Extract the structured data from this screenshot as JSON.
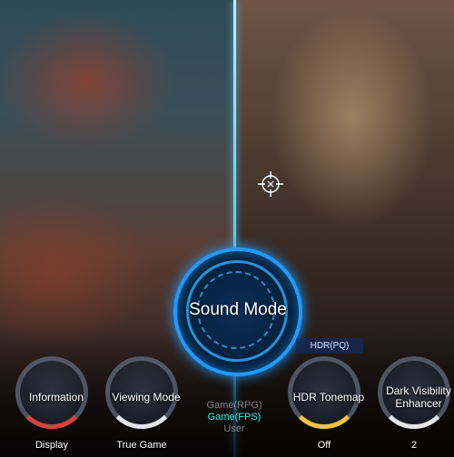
{
  "center": {
    "label": "Sound Mode"
  },
  "dials": [
    {
      "label": "Information",
      "value": "Display"
    },
    {
      "label": "Viewing Mode",
      "value": "True Game"
    },
    {
      "label": "HDR Tonemap",
      "value": "Off",
      "option": "HDR(PQ)"
    },
    {
      "label": "Dark Visibility Enhancer",
      "value": "2"
    }
  ],
  "sound_options": [
    {
      "label": "Game(RPG)"
    },
    {
      "label": "Game(FPS)",
      "selected": true
    },
    {
      "label": "User"
    }
  ],
  "colors": {
    "accent": "#1f9bff",
    "selected": "#35f0e3",
    "info_arc": "#d94040",
    "view_arc": "#ffffff",
    "hdr_arc": "#f2c43a",
    "dve_arc": "#ffffff"
  },
  "icons": {
    "crosshair": "crosshair-icon"
  }
}
